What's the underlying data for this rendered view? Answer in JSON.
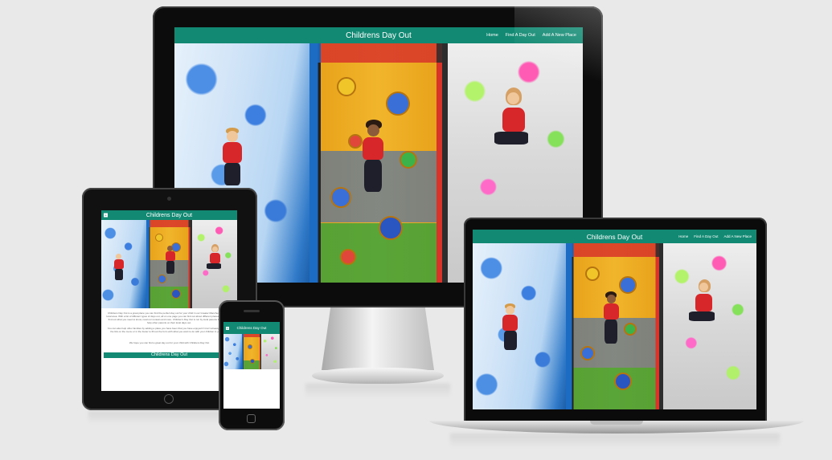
{
  "site": {
    "brand": "Childrens Day Out",
    "nav": [
      "Home",
      "Find A Day Out",
      "Add A New Place"
    ],
    "menu_icon": "hamburger-menu-icon"
  },
  "tablet": {
    "paragraphs": [
      "Childrens Day Out is a great place you can find the perfect day out for your child in our Greater Manchester and the local area. With a list of different types of days out, all on one page you can find out about different places you can go, find out what you need to know, read our reviews and more. Children's Day Out is run by local parents that want to help other parents on their local days out.",
      "You can also help other families by adding a place you have been that you have enjoyed if it isn't already here. Click the link on the menu or in the footer to fill out the form with what you want to do with your children in your area.",
      "We hope you can find a great day out for your child with Childrens Day Out"
    ],
    "button_label": "Childrens Day Out"
  },
  "colors": {
    "brand": "#128a73",
    "page_background": "#e9e9e9",
    "device_black": "#0c0c0c"
  }
}
